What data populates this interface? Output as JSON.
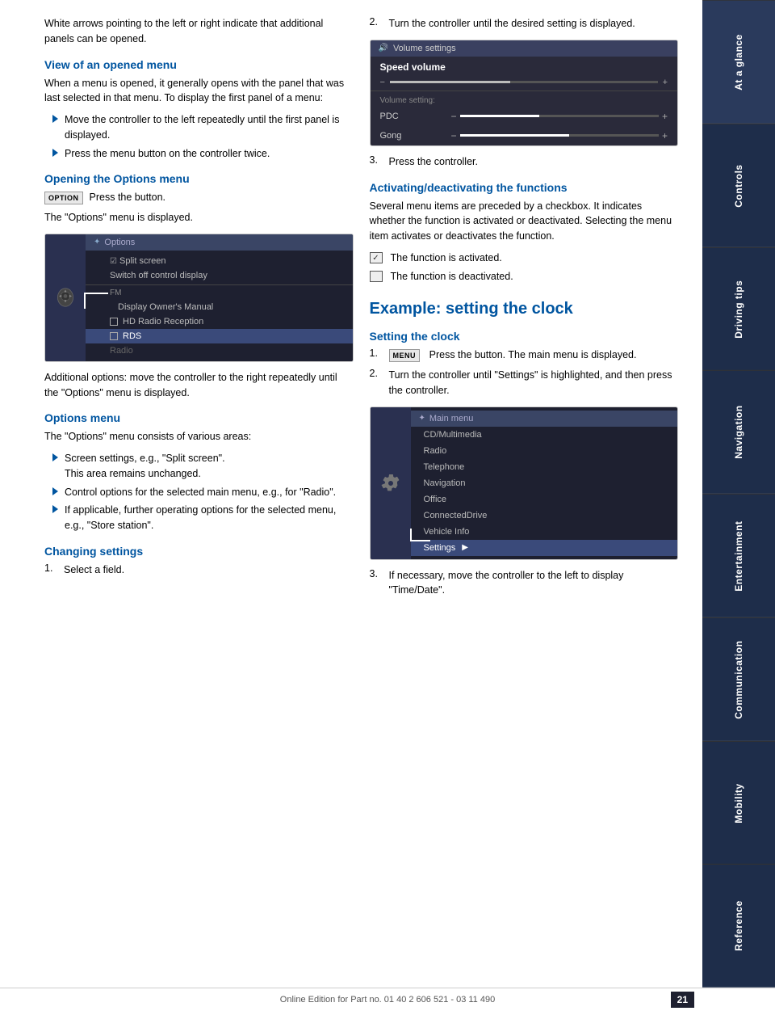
{
  "sidebar": {
    "tabs": [
      {
        "label": "At a glance",
        "active": true
      },
      {
        "label": "Controls",
        "active": false
      },
      {
        "label": "Driving tips",
        "active": false
      },
      {
        "label": "Navigation",
        "active": false
      },
      {
        "label": "Entertainment",
        "active": false
      },
      {
        "label": "Communication",
        "active": false
      },
      {
        "label": "Mobility",
        "active": false
      },
      {
        "label": "Reference",
        "active": false
      }
    ]
  },
  "page": {
    "number": "21",
    "footer_text": "Online Edition for Part no. 01 40 2 606 521 - 03 11 490"
  },
  "col_left": {
    "intro_text": "White arrows pointing to the left or right indicate that additional panels can be opened.",
    "section1": {
      "heading": "View of an opened menu",
      "body": "When a menu is opened, it generally opens with the panel that was last selected in that menu. To display the first panel of a menu:",
      "bullets": [
        "Move the controller to the left repeatedly until the first panel is displayed.",
        "Press the menu button on the controller twice."
      ]
    },
    "section2": {
      "heading": "Opening the Options menu",
      "button_label": "OPTION",
      "body1": "Press the button.",
      "body2": "The \"Options\" menu is displayed.",
      "screenshot": {
        "header": "Options",
        "items": [
          {
            "label": "Split screen",
            "type": "checked",
            "selected": false
          },
          {
            "label": "Switch off control display",
            "type": "normal",
            "selected": false
          },
          {
            "label": "FM",
            "type": "section",
            "selected": false
          },
          {
            "label": "Display Owner's Manual",
            "type": "normal",
            "selected": false
          },
          {
            "label": "HD Radio Reception",
            "type": "checkbox",
            "selected": false
          },
          {
            "label": "RDS",
            "type": "checkbox",
            "selected": true
          },
          {
            "label": "Radio",
            "type": "normal",
            "selected": false
          }
        ]
      },
      "additional_text": "Additional options: move the controller to the right repeatedly until the \"Options\" menu is displayed."
    },
    "section3": {
      "heading": "Options menu",
      "body": "The \"Options\" menu consists of various areas:",
      "bullets": [
        {
          "text": "Screen settings, e.g., \"Split screen\".",
          "sub": "This area remains unchanged."
        },
        {
          "text": "Control options for the selected main menu, e.g., for \"Radio\"."
        },
        {
          "text": "If applicable, further operating options for the selected menu, e.g., \"Store station\"."
        }
      ]
    },
    "section4": {
      "heading": "Changing settings",
      "step1": "Select a field."
    }
  },
  "col_right": {
    "step2": "Turn the controller until the desired setting is displayed.",
    "step3": "Press the controller.",
    "volume_screenshot": {
      "header": "Volume settings",
      "speed_volume_label": "Speed volume",
      "slider_items": [
        {
          "label": "PDC",
          "fill": 40
        },
        {
          "label": "Gong",
          "fill": 55
        }
      ]
    },
    "section_activating": {
      "heading": "Activating/deactivating the functions",
      "body": "Several menu items are preceded by a checkbox. It indicates whether the function is activated or deactivated. Selecting the menu item activates or deactivates the function.",
      "activated_text": "The function is activated.",
      "deactivated_text": "The function is deactivated."
    },
    "example": {
      "heading": "Example: setting the clock",
      "subsection": "Setting the clock",
      "steps": [
        {
          "num": "1.",
          "button": "MENU",
          "text": "Press the button. The main menu is displayed."
        },
        {
          "num": "2.",
          "text": "Turn the controller until \"Settings\" is highlighted, and then press the controller."
        },
        {
          "num": "3.",
          "text": "If necessary, move the controller to the left to display \"Time/Date\"."
        }
      ],
      "main_menu_screenshot": {
        "header": "Main menu",
        "items": [
          "CD/Multimedia",
          "Radio",
          "Telephone",
          "Navigation",
          "Office",
          "ConnectedDrive",
          "Vehicle Info",
          "Settings"
        ],
        "selected": "Settings"
      }
    }
  }
}
